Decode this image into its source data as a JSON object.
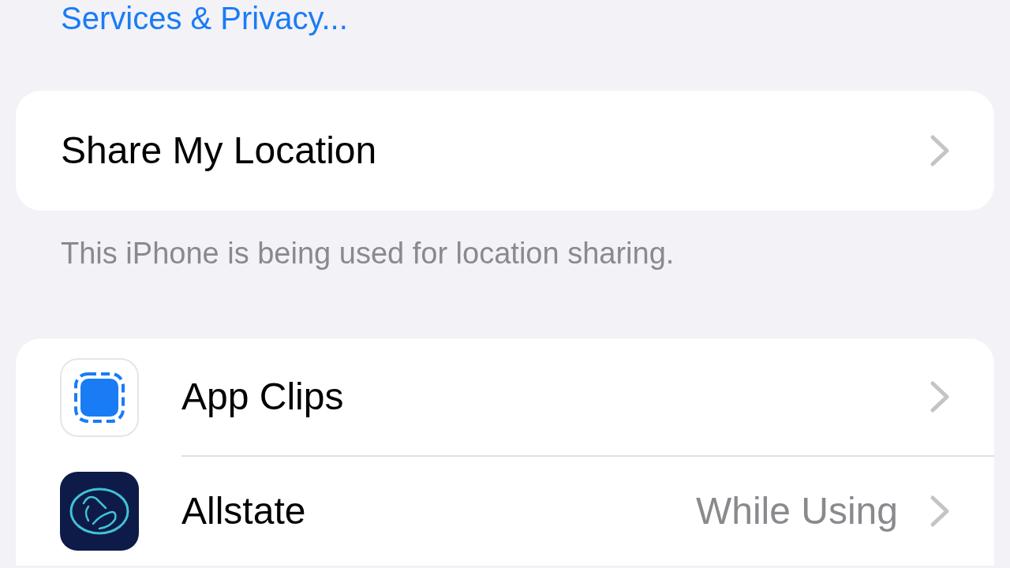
{
  "header_link": "Services & Privacy...",
  "share_section": {
    "label": "Share My Location",
    "footer": "This iPhone is being used for location sharing."
  },
  "apps": [
    {
      "kind": "app_clips",
      "name": "App Clips"
    },
    {
      "kind": "allstate",
      "name": "Allstate",
      "value": "While Using"
    }
  ]
}
